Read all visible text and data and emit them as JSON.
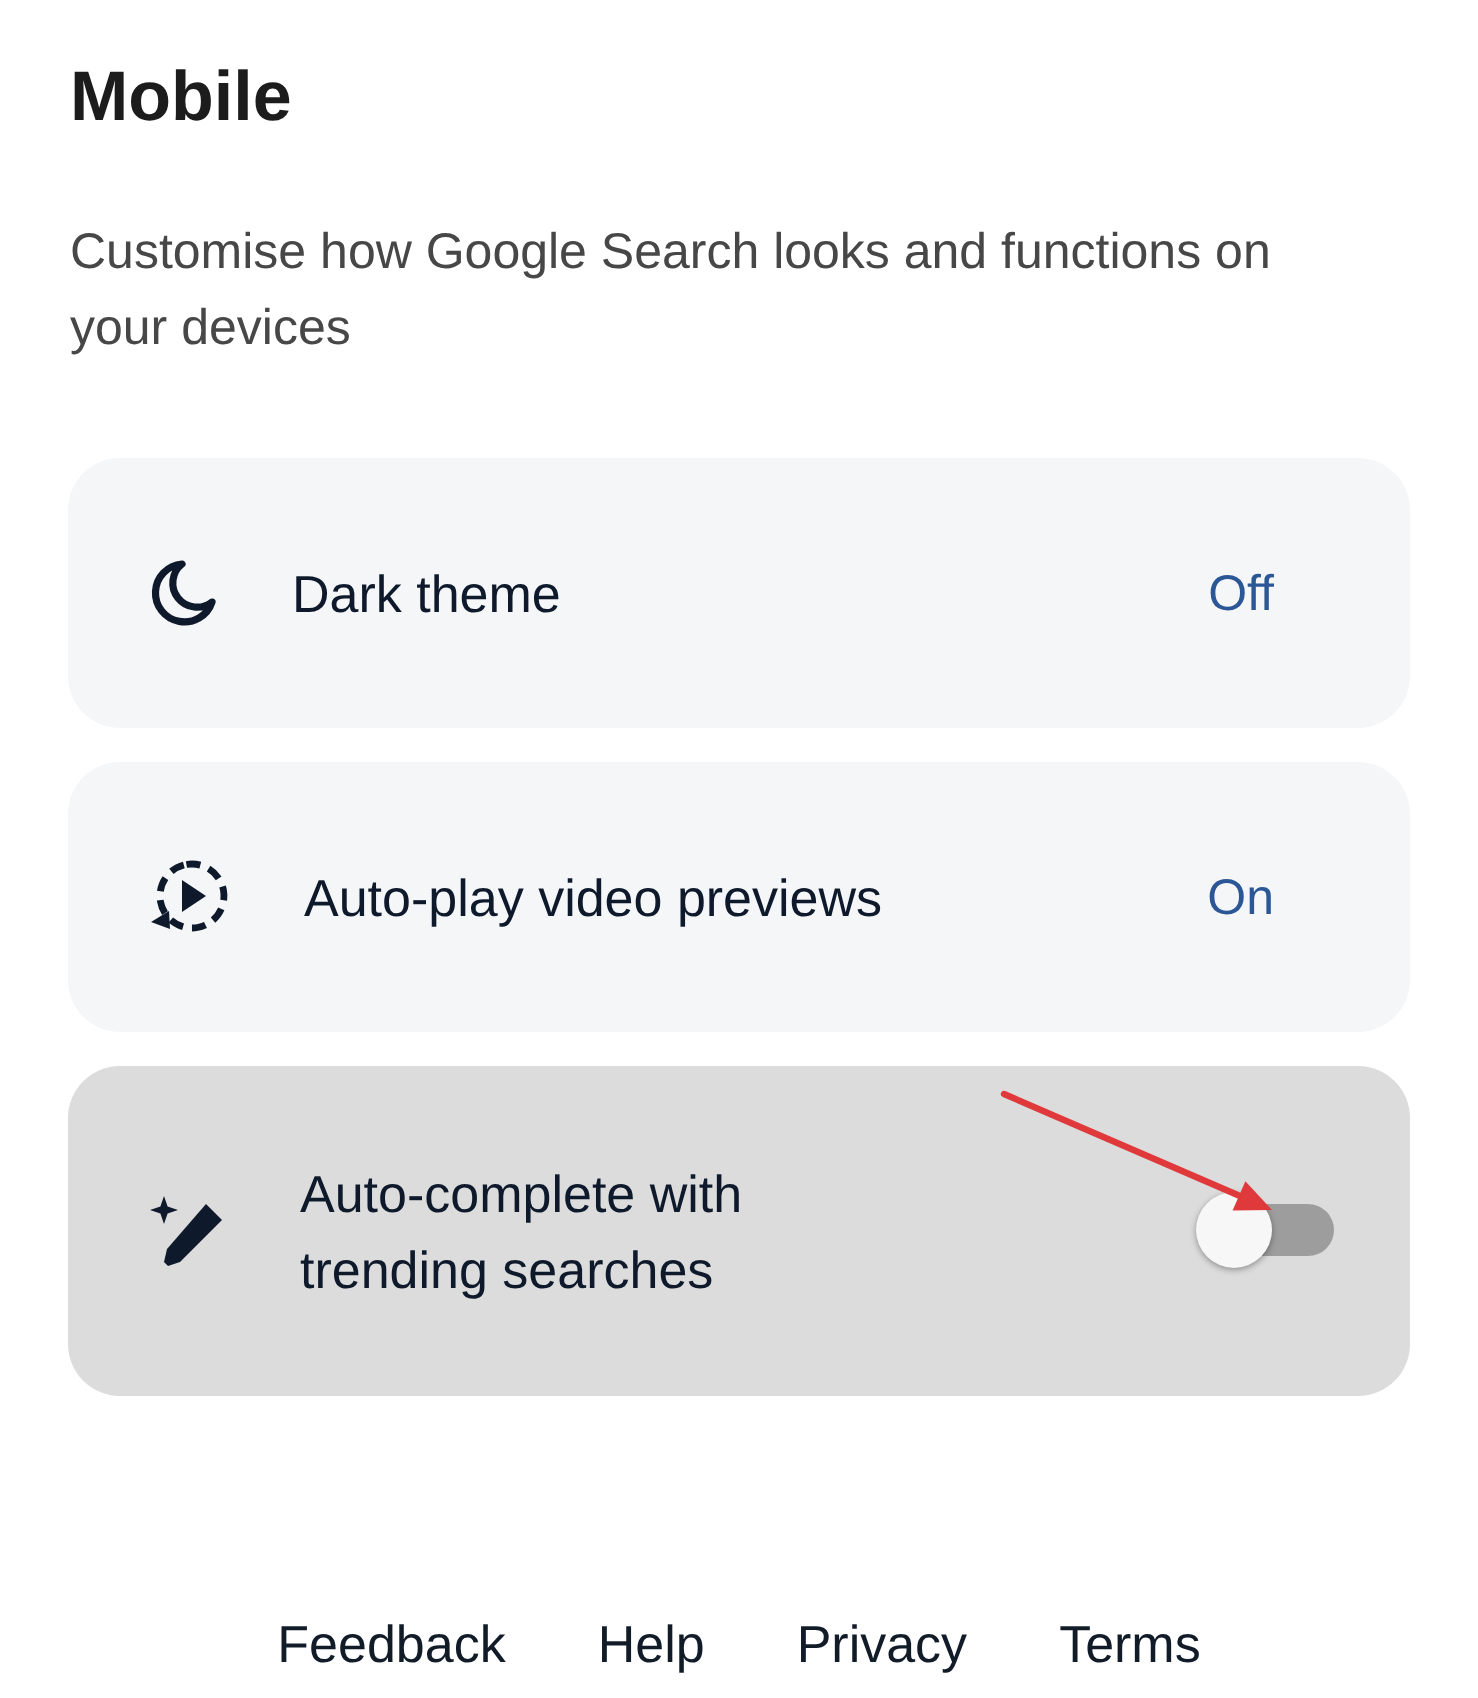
{
  "page": {
    "title": "Mobile",
    "description": "Customise how Google Search looks and functions on your devices"
  },
  "settings": [
    {
      "kind": "value",
      "label": "Dark theme",
      "value": "Off",
      "highlighted": false,
      "arrow_marker": false
    },
    {
      "kind": "value",
      "label": "Auto-play video previews",
      "value": "On",
      "highlighted": false,
      "arrow_marker": false
    },
    {
      "kind": "toggle",
      "label": "Auto-complete with trending searches",
      "on": false,
      "highlighted": true,
      "arrow_marker": true
    }
  ],
  "footer_links": [
    "Feedback",
    "Help",
    "Privacy",
    "Terms"
  ]
}
